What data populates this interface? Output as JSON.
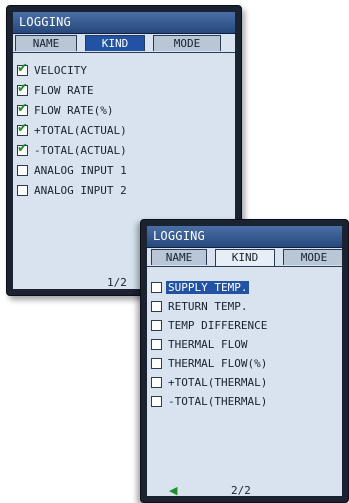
{
  "screen1": {
    "title": "LOGGING",
    "tabs": [
      {
        "label": "NAME",
        "active": false
      },
      {
        "label": "KIND",
        "active": true
      },
      {
        "label": "MODE",
        "active": false
      }
    ],
    "items": [
      {
        "label": "VELOCITY",
        "checked": true
      },
      {
        "label": "FLOW RATE",
        "checked": true
      },
      {
        "label": "FLOW RATE(%)",
        "checked": true
      },
      {
        "label": "+TOTAL(ACTUAL)",
        "checked": true
      },
      {
        "label": "-TOTAL(ACTUAL)",
        "checked": true
      },
      {
        "label": "ANALOG INPUT 1",
        "checked": false
      },
      {
        "label": "ANALOG INPUT 2",
        "checked": false
      }
    ],
    "page_indicator": "1/2"
  },
  "screen2": {
    "title": "LOGGING",
    "tabs": [
      {
        "label": "NAME",
        "active": false
      },
      {
        "label": "KIND",
        "active": true
      },
      {
        "label": "MODE",
        "active": false
      }
    ],
    "items": [
      {
        "label": "SUPPLY TEMP.",
        "checked": false,
        "selected": true
      },
      {
        "label": "RETURN TEMP.",
        "checked": false,
        "selected": false
      },
      {
        "label": "TEMP DIFFERENCE",
        "checked": false,
        "selected": false
      },
      {
        "label": "THERMAL FLOW",
        "checked": false,
        "selected": false
      },
      {
        "label": "THERMAL FLOW(%)",
        "checked": false,
        "selected": false
      },
      {
        "label": "+TOTAL(THERMAL)",
        "checked": false,
        "selected": false
      },
      {
        "label": "-TOTAL(THERMAL)",
        "checked": false,
        "selected": false
      }
    ],
    "page_indicator": "2/2",
    "prev_arrow_icon": "triangle-left-icon"
  },
  "colors": {
    "title_bar": "#26487c",
    "screen_bg": "#d9e3ef",
    "highlight": "#2252a4",
    "check": "#1e8f2a",
    "bezel": "#1b2232"
  }
}
